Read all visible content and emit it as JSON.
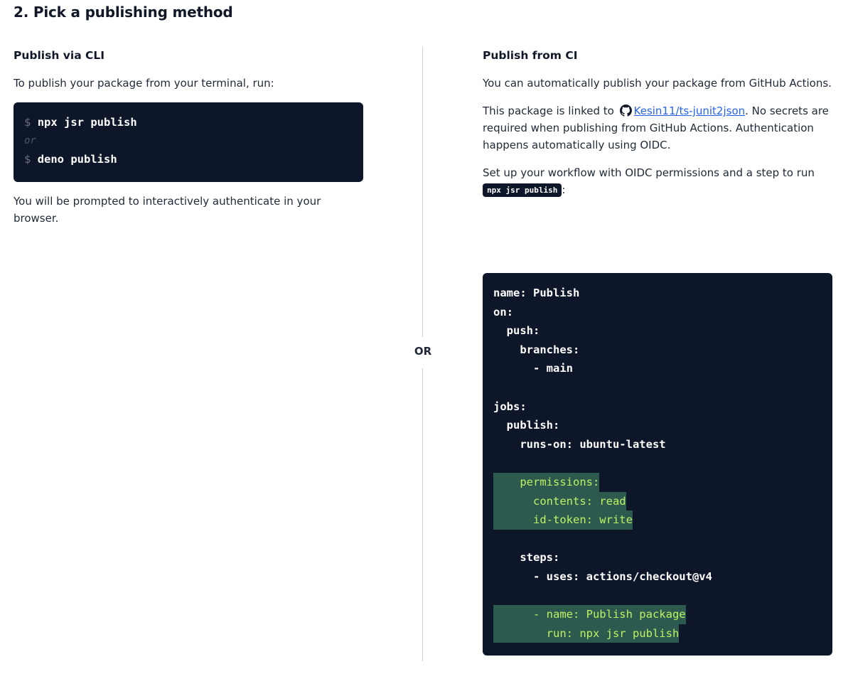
{
  "page_title": "2. Pick a publishing method",
  "cli": {
    "heading": "Publish via CLI",
    "intro": "To publish your package from your terminal, run:",
    "commands": [
      {
        "prompt": "$",
        "text": "npx jsr publish"
      },
      {
        "comment": "or"
      },
      {
        "prompt": "$",
        "text": "deno publish"
      }
    ],
    "note": "You will be prompted to interactively authenticate in your browser."
  },
  "divider_label": "OR",
  "ci": {
    "heading": "Publish from CI",
    "intro": "You can automatically publish your package from GitHub Actions.",
    "linked_prefix": "This package is linked to",
    "repo_link": "Kesin11/ts-junit2json",
    "linked_suffix": ". No secrets are required when publishing from GitHub Actions. Authentication happens automatically using OIDC.",
    "workflow_prefix": "Set up your workflow with OIDC permissions and a step to run",
    "workflow_command": "npx jsr publish",
    "workflow_suffix": ":",
    "yaml_lines": [
      {
        "text": "name: Publish",
        "highlight": false
      },
      {
        "text": "on:",
        "highlight": false
      },
      {
        "text": "  push:",
        "highlight": false
      },
      {
        "text": "    branches:",
        "highlight": false
      },
      {
        "text": "      - main",
        "highlight": false
      },
      {
        "text": "",
        "highlight": false
      },
      {
        "text": "jobs:",
        "highlight": false
      },
      {
        "text": "  publish:",
        "highlight": false
      },
      {
        "text": "    runs-on: ubuntu-latest",
        "highlight": false
      },
      {
        "text": "",
        "highlight": false
      },
      {
        "text": "    permissions:",
        "highlight": true
      },
      {
        "text": "      contents: read",
        "highlight": true
      },
      {
        "text": "      id-token: write",
        "highlight": true
      },
      {
        "text": "",
        "highlight": false
      },
      {
        "text": "    steps:",
        "highlight": false
      },
      {
        "text": "      - uses: actions/checkout@v4",
        "highlight": false
      },
      {
        "text": "",
        "highlight": false
      },
      {
        "text": "      - name: Publish package",
        "highlight": true
      },
      {
        "text": "        run: npx jsr publish",
        "highlight": true
      }
    ]
  },
  "colors": {
    "code_bg": "#0e1629",
    "highlight_bg": "#2d5a4f",
    "highlight_text": "#bef264",
    "link": "#2563eb"
  },
  "icons": {
    "repo": "github-icon"
  }
}
